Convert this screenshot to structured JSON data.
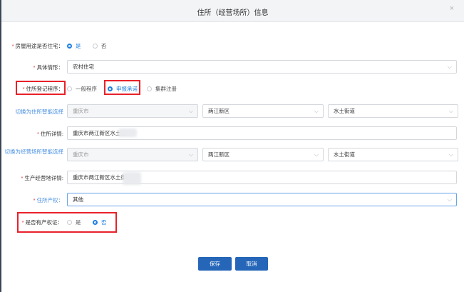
{
  "dialog": {
    "title": "住所（经营场所）信息",
    "close_icon": "×"
  },
  "is_residence": {
    "label": "房屋用途是否住宅：",
    "options": [
      "是",
      "否"
    ],
    "selected": "是"
  },
  "specific_situation": {
    "label": "具体情形：",
    "value": "农村住宅"
  },
  "registration_procedure": {
    "label": "住所登记程序：",
    "options": [
      "一般程序",
      "申报承诺",
      "集群注册"
    ],
    "selected": "申报承诺"
  },
  "residence_smart_select": {
    "label": "切换为住所智能选择",
    "city": "重庆市",
    "district": "两江新区",
    "street": "水土街道"
  },
  "residence_detail": {
    "label": "住所详情:",
    "value": "重庆市两江新区水土街"
  },
  "business_smart_select": {
    "label": "切换为经营场所智能选择",
    "city": "重庆市",
    "district": "两江新区",
    "street": "水土街道"
  },
  "business_detail": {
    "label": "生产经营地详情:",
    "value": "重庆市两江新区水土街"
  },
  "property_right": {
    "label": "住所产权：",
    "value": "其他"
  },
  "has_certificate": {
    "label": "是否有产权证：",
    "options": [
      "是",
      "否"
    ],
    "selected": "否"
  },
  "buttons": {
    "save": "保存",
    "cancel": "取消"
  },
  "colors": {
    "accent": "#1e7fe0",
    "button": "#2566b8",
    "highlight_box": "#e8212a",
    "required": "#e0393e"
  }
}
